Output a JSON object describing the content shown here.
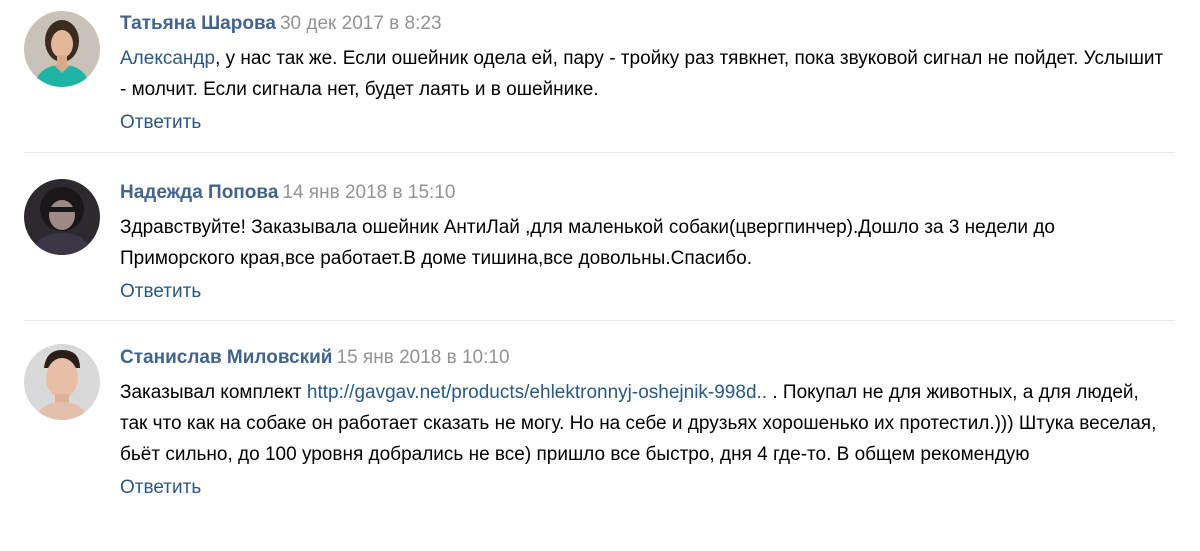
{
  "colors": {
    "author": "#42648b",
    "date": "#939393",
    "link": "#2a5885",
    "divider": "#e7e8ec"
  },
  "comments": [
    {
      "author": "Татьяна Шарова",
      "date": "30 дек 2017 в 8:23",
      "mention": "Александр",
      "text": ", у нас так же. Если ошейник одела ей, пару - тройку раз тявкнет, пока звуковой сигнал не пойдет. Услышит - молчит. Если сигнала нет, будет лаять и в ошейнике.",
      "reply_label": "Ответить",
      "avatar_icon": "woman-portrait-avatar"
    },
    {
      "author": "Надежда Попова",
      "date": "14 янв 2018 в 15:10",
      "text": "Здравствуйте! Заказывала ошейник АнтиЛай ,для маленькой собаки(цвергпинчер).Дошло за 3 недели до Приморского края,все работает.В доме тишина,все довольны.Спасибо.",
      "reply_label": "Ответить",
      "avatar_icon": "woman-dark-portrait-avatar"
    },
    {
      "author": "Станислав Миловский",
      "date": "15 янв 2018 в 10:10",
      "text_before": "Заказывал комплект ",
      "link": "http://gavgav.net/products/ehlektronnyj-oshejnik-998d..",
      "text_after": " . Покупал не для животных, а для людей, так что как на собаке он работает сказать не могу. Но на себе и друзьях хорошенько их протестил.))) Штука веселая, бьёт сильно, до 100 уровня добрались не все) пришло все быстро, дня 4 где-то. В общем рекомендую",
      "reply_label": "Ответить",
      "avatar_icon": "man-portrait-avatar"
    }
  ]
}
